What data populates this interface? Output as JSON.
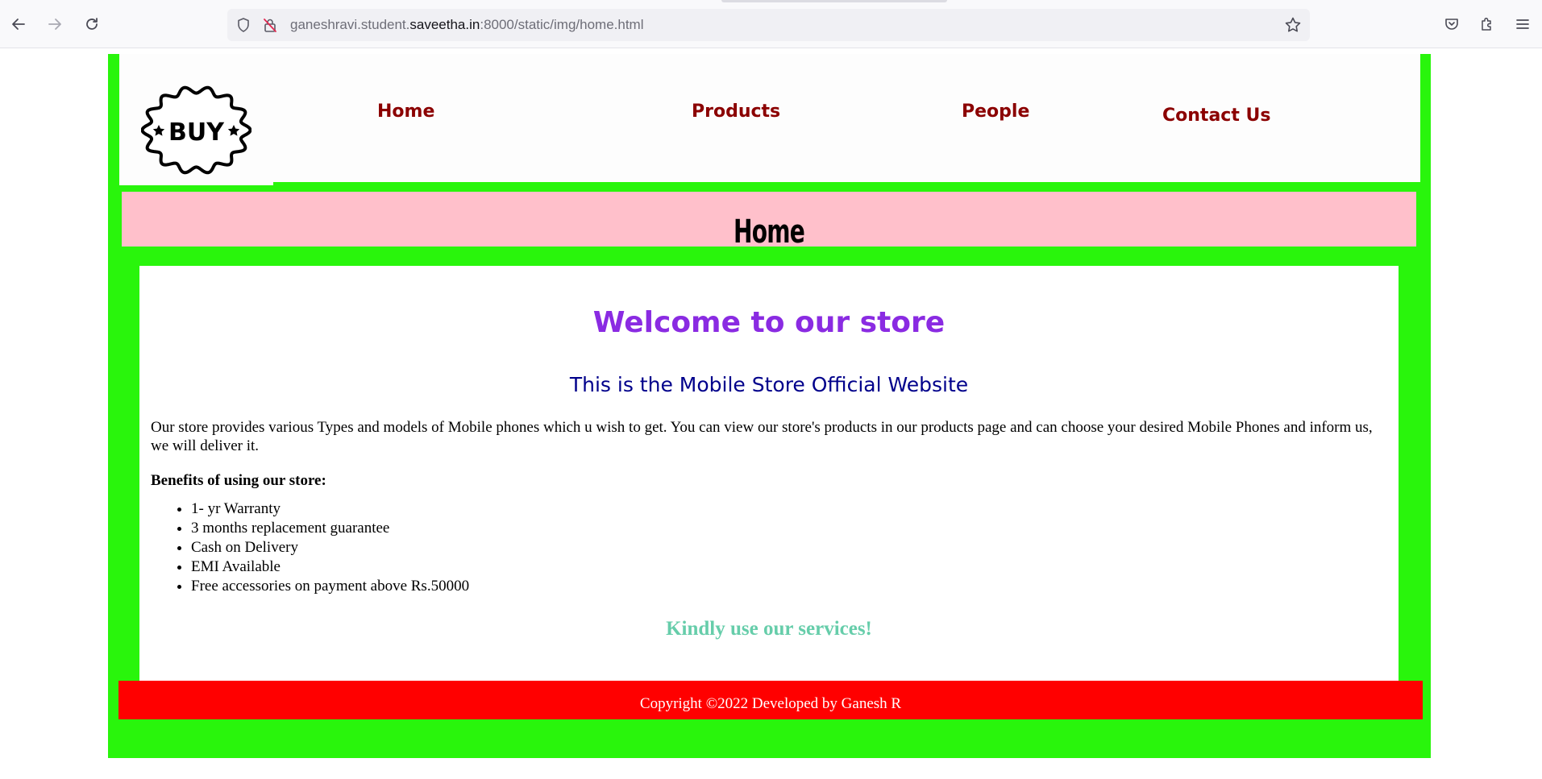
{
  "browser": {
    "url_prefix": "ganeshravi.student.",
    "url_domain": "saveetha.in",
    "url_suffix": ":8000/static/img/home.html"
  },
  "header": {
    "logo_text": "BUY",
    "nav": [
      {
        "label": "Home"
      },
      {
        "label": "Products"
      },
      {
        "label": "People"
      },
      {
        "label": "Contact Us"
      }
    ]
  },
  "banner": {
    "title": "Home"
  },
  "content": {
    "welcome": "Welcome to our store",
    "subtitle": "This is the Mobile Store Official Website",
    "paragraph": "Our store provides various Types and models of Mobile phones which u wish to get. You can view our store's products in our products page and can choose your desired Mobile Phones and inform us, we will deliver it.",
    "benefits_heading": "Benefits of using our store:",
    "benefits": [
      "1- yr Warranty",
      "3 months replacement guarantee",
      "Cash on Delivery",
      "EMI Available",
      "Free accessories on payment above Rs.50000"
    ],
    "closing": "Kindly use our services!"
  },
  "footer": {
    "text": "Copyright ©2022 Developed by Ganesh R"
  },
  "colors": {
    "frame_green": "#29f50c",
    "banner_pink": "#ffc0cb",
    "nav_dark_red": "#8b0000",
    "welcome_purple": "#8a2be2",
    "subtitle_navy": "#00008b",
    "closing_aquamarine": "#66cdaa",
    "footer_red": "#ff0000"
  }
}
